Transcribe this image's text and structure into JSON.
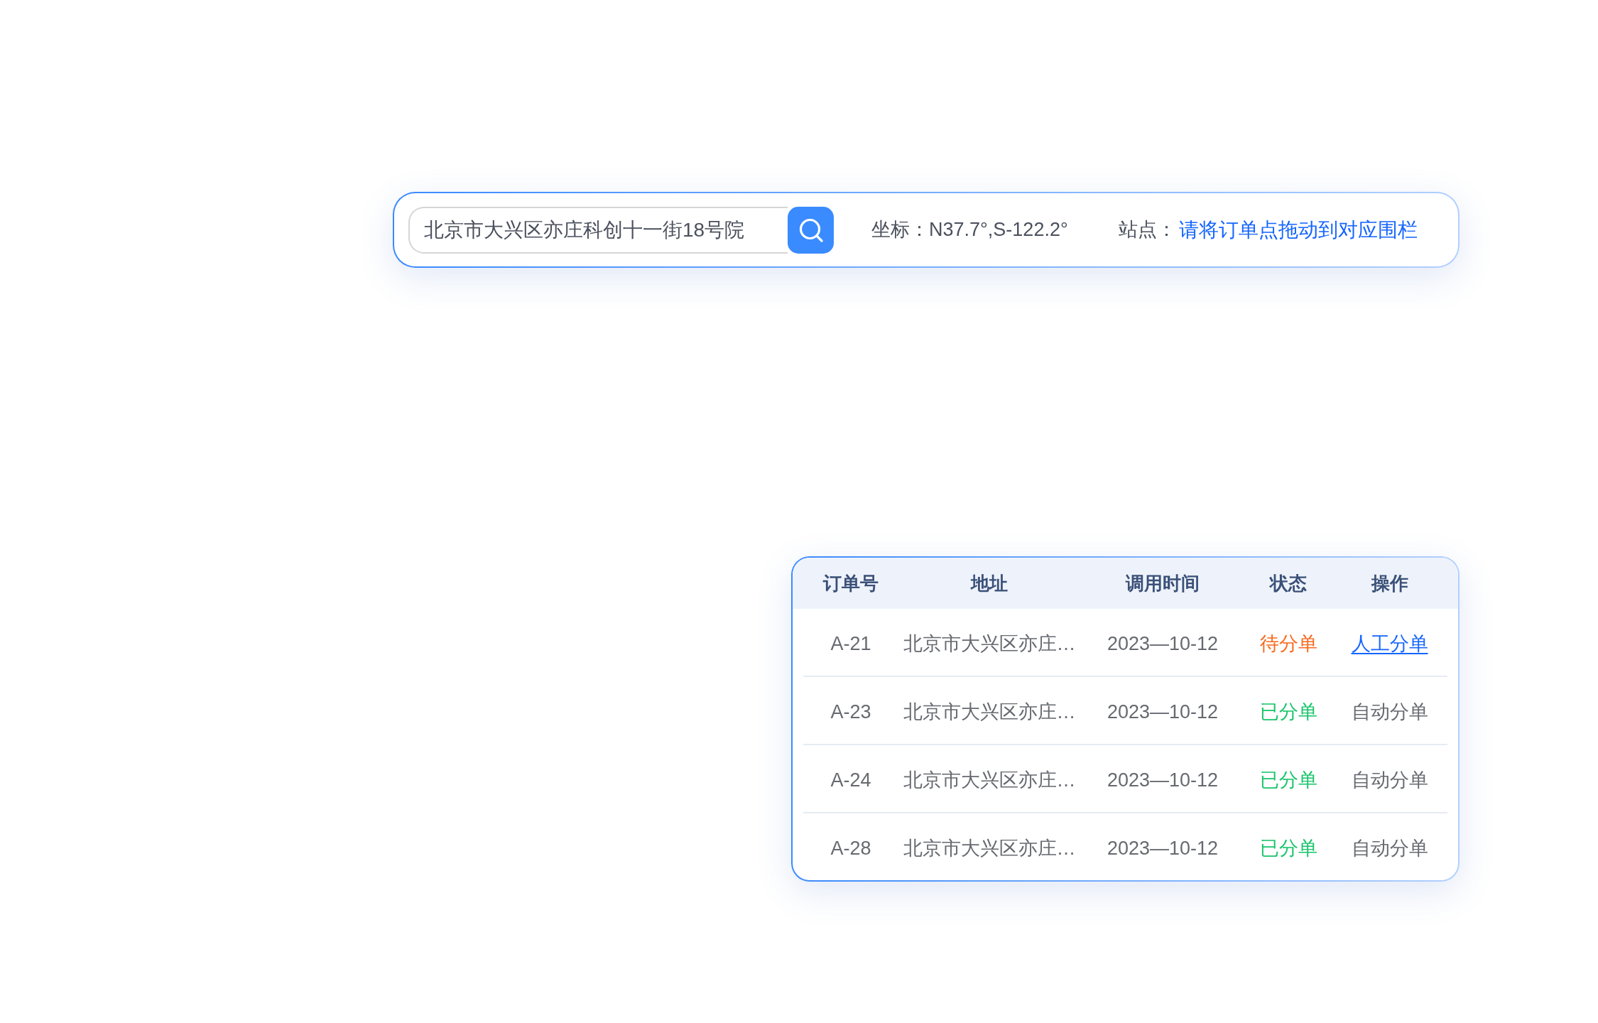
{
  "search_bar": {
    "address_field": {
      "value": "北京市大兴区亦庄科创十一街18号院"
    },
    "coordinates": {
      "label": "坐标：",
      "value": "N37.7°,S-122.2°"
    },
    "station": {
      "label": "站点：",
      "hint": "请将订单点拖动到对应围栏"
    }
  },
  "order_table": {
    "columns": [
      "订单号",
      "地址",
      "调用时间",
      "状态",
      "操作"
    ],
    "rows": [
      {
        "order_no": "A-21",
        "address": "北京市大兴区亦庄…",
        "time": "2023—10-12",
        "status": {
          "text": "待分单",
          "color": "#fa6a1e"
        },
        "action": {
          "text": "人工分单",
          "kind": "link"
        }
      },
      {
        "order_no": "A-23",
        "address": "北京市大兴区亦庄…",
        "time": "2023—10-12",
        "status": {
          "text": "已分单",
          "color": "#19c46a"
        },
        "action": {
          "text": "自动分单",
          "kind": "text"
        }
      },
      {
        "order_no": "A-24",
        "address": "北京市大兴区亦庄…",
        "time": "2023—10-12",
        "status": {
          "text": "已分单",
          "color": "#19c46a"
        },
        "action": {
          "text": "自动分单",
          "kind": "text"
        }
      },
      {
        "order_no": "A-28",
        "address": "北京市大兴区亦庄…",
        "time": "2023—10-12",
        "status": {
          "text": "已分单",
          "color": "#19c46a"
        },
        "action": {
          "text": "自动分单",
          "kind": "text"
        }
      }
    ]
  }
}
